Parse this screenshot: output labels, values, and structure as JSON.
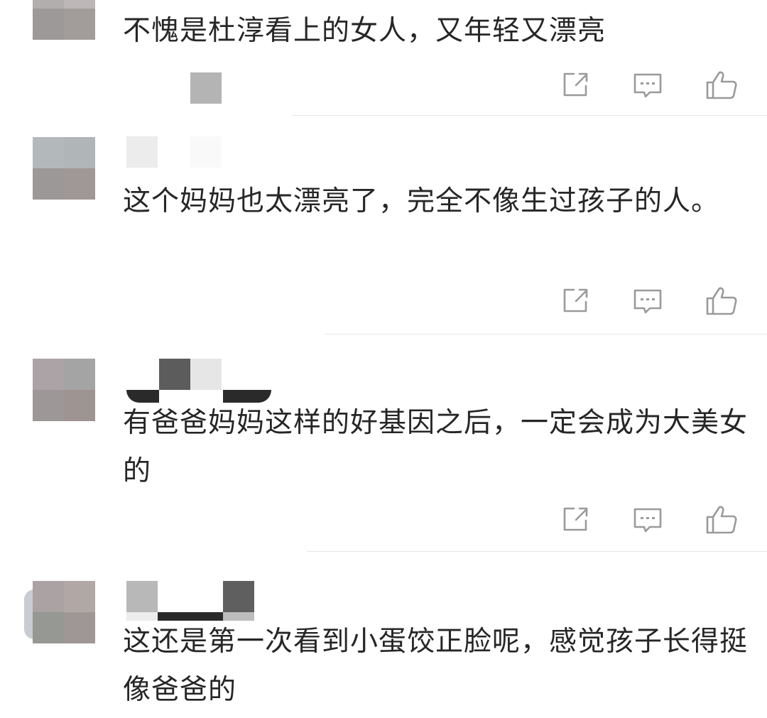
{
  "comments": [
    {
      "text": "不愧是杜淳看上的女人，又年轻又漂亮",
      "actions": {
        "share": "share-icon",
        "reply": "comment-icon",
        "like": "thumbs-up-icon"
      }
    },
    {
      "text": "这个妈妈也太漂亮了，完全不像生过孩子的人。",
      "actions": {
        "share": "share-icon",
        "reply": "comment-icon",
        "like": "thumbs-up-icon"
      }
    },
    {
      "text": "有爸爸妈妈这样的好基因之后，一定会成为大美女的",
      "actions": {
        "share": "share-icon",
        "reply": "comment-icon",
        "like": "thumbs-up-icon"
      }
    },
    {
      "text": "这还是第一次看到小蛋饺正脸呢，感觉孩子长得挺像爸爸的"
    }
  ],
  "colors": {
    "icon": "#9a9a9a",
    "divider": "#e6e6e6",
    "text": "#262626"
  }
}
